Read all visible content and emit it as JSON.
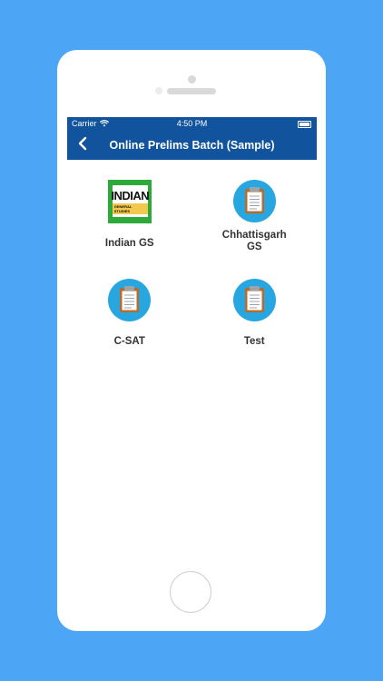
{
  "status_bar": {
    "carrier": "Carrier",
    "time": "4:50 PM"
  },
  "nav_bar": {
    "back_icon": "chevron-left-icon",
    "title": "Online Prelims Batch (Sample)"
  },
  "tiles": [
    {
      "label": "Indian GS",
      "icon": "book-cover-icon",
      "cover_title": "INDIAN",
      "cover_subtitle": "GENERAL STUDIES"
    },
    {
      "label": "Chhattisgarh GS",
      "icon": "clipboard-icon"
    },
    {
      "label": "C-SAT",
      "icon": "clipboard-icon"
    },
    {
      "label": "Test",
      "icon": "clipboard-icon"
    }
  ],
  "colors": {
    "background": "#4da6f5",
    "nav_bar": "#11539c",
    "icon_circle": "#27a6df"
  }
}
